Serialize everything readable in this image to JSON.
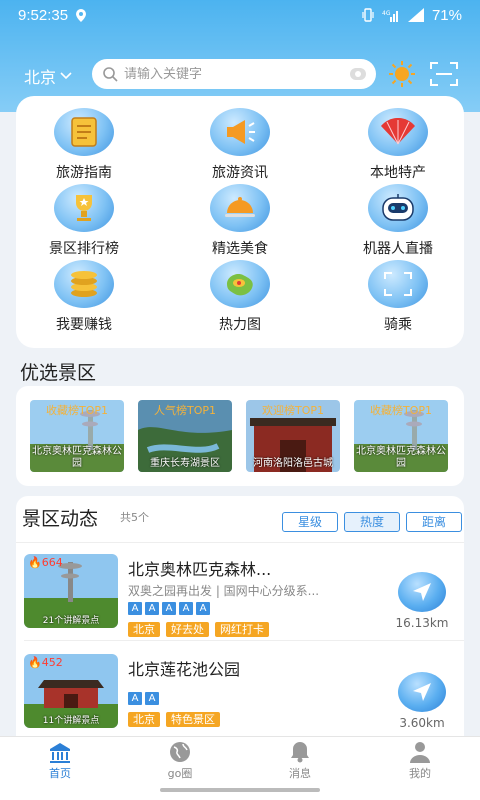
{
  "status": {
    "time": "9:52:35",
    "battery": "71%"
  },
  "header": {
    "city": "北京",
    "search_placeholder": "请输入关键字"
  },
  "categories": [
    {
      "label": "旅游指南",
      "icon": "guide-icon"
    },
    {
      "label": "旅游资讯",
      "icon": "megaphone-icon"
    },
    {
      "label": "本地特产",
      "icon": "fan-icon"
    },
    {
      "label": "景区排行榜",
      "icon": "trophy-icon"
    },
    {
      "label": "精选美食",
      "icon": "food-cover-icon"
    },
    {
      "label": "机器人直播",
      "icon": "robot-icon"
    },
    {
      "label": "我要赚钱",
      "icon": "coins-icon"
    },
    {
      "label": "热力图",
      "icon": "heatmap-icon"
    },
    {
      "label": "骑乘",
      "icon": "scan-icon"
    }
  ],
  "featured": {
    "title": "优选景区",
    "items": [
      {
        "badge": "收藏榜TOP1",
        "name": "北京奥林匹克森林公园"
      },
      {
        "badge": "人气榜TOP1",
        "name": "重庆长寿湖景区"
      },
      {
        "badge": "欢迎榜TOP1",
        "name": "河南洛阳洛邑古城"
      },
      {
        "badge": "收藏榜TOP1",
        "name": "北京奥林匹克森林公园"
      }
    ]
  },
  "dynamics": {
    "title": "景区动态",
    "count": "共5个",
    "sort": [
      "星级",
      "热度",
      "距离"
    ],
    "active_sort": "热度",
    "spots": [
      {
        "heat": "664",
        "guides": "21个讲解景点",
        "name": "北京奥林匹克森林...",
        "desc": "双奥之园再出发 | 国网中心分级系...",
        "stars": [
          "A",
          "A",
          "A",
          "A",
          "A"
        ],
        "tags": [
          "北京",
          "好去处",
          "网红打卡"
        ],
        "distance": "16.13km"
      },
      {
        "heat": "452",
        "guides": "11个讲解景点",
        "name": "北京莲花池公园",
        "desc": "",
        "stars": [
          "A",
          "A"
        ],
        "tags": [
          "北京",
          "特色景区"
        ],
        "distance": "3.60km"
      }
    ]
  },
  "tabbar": [
    {
      "label": "首页",
      "icon": "home-icon"
    },
    {
      "label": "go圈",
      "icon": "globe-icon"
    },
    {
      "label": "消息",
      "icon": "bell-icon"
    },
    {
      "label": "我的",
      "icon": "user-icon"
    }
  ],
  "colors": {
    "accent": "#2b7fd6",
    "header": "#4cb3f0",
    "tag": "#f5a623",
    "heat": "#ff3b30"
  }
}
